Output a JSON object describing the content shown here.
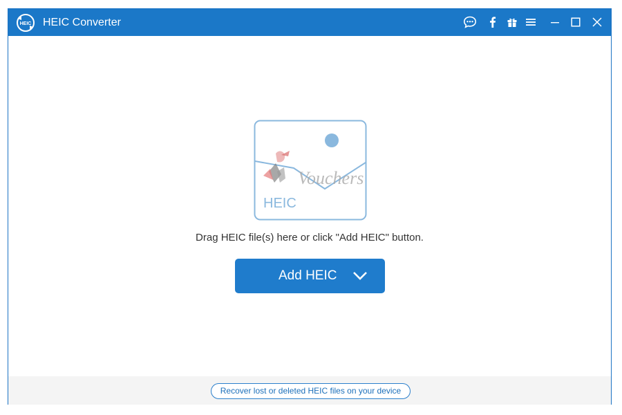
{
  "window": {
    "title": "HEIC Converter",
    "logo_text": "HEIC"
  },
  "titlebar_icons": [
    "chat-bubble-icon",
    "facebook-icon",
    "gift-icon",
    "menu-icon",
    "minimize-icon",
    "maximize-icon",
    "close-icon"
  ],
  "drop_zone": {
    "image_label": "HEIC",
    "watermark_text": "Vouchers",
    "instruction": "Drag HEIC file(s) here or click \"Add HEIC\" button."
  },
  "add_button": {
    "label": "Add HEIC"
  },
  "footer": {
    "recover_link": "Recover lost or deleted HEIC files on your device"
  },
  "colors": {
    "titlebar": "#1b78c8",
    "accent": "#1f7ccc",
    "placeholder": "#8ab8de",
    "footer_bg": "#f4f4f4"
  }
}
